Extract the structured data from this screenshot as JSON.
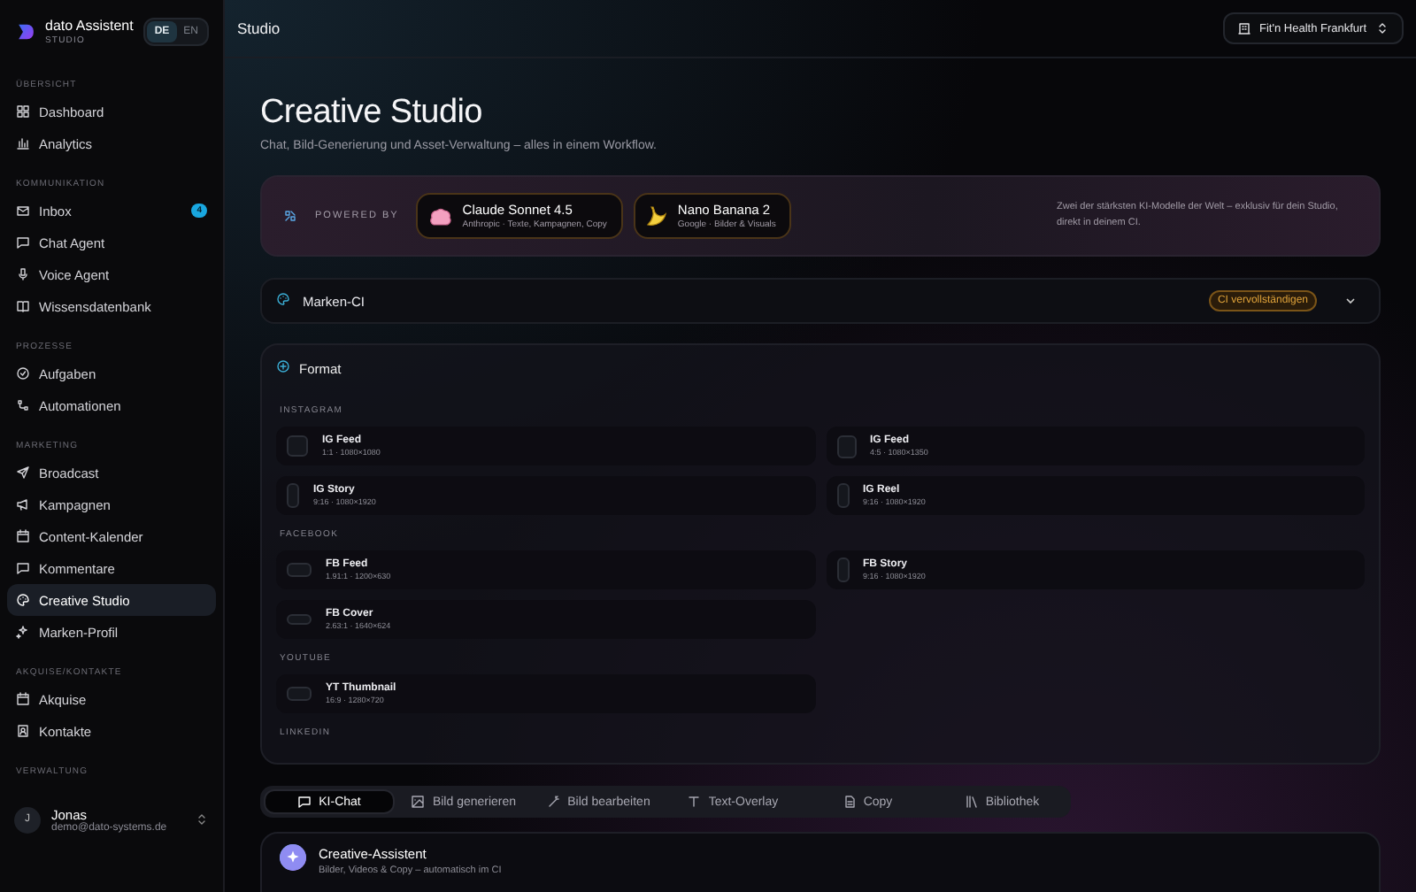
{
  "sidebar": {
    "brand": {
      "name": "dato Assistent",
      "subtitle": "STUDIO"
    },
    "languages": [
      {
        "label": "DE",
        "selected": true
      },
      {
        "label": "EN",
        "selected": false
      }
    ],
    "sections": [
      {
        "title": "ÜBERSICHT",
        "items": [
          {
            "label": "Dashboard",
            "selected": false
          },
          {
            "label": "Analytics",
            "selected": false
          }
        ]
      },
      {
        "title": "KOMMUNIKATION",
        "items": [
          {
            "label": "Inbox",
            "selected": false,
            "badge": "4"
          },
          {
            "label": "Chat Agent",
            "selected": false
          },
          {
            "label": "Voice Agent",
            "selected": false
          },
          {
            "label": "Wissensdatenbank",
            "selected": false
          }
        ]
      },
      {
        "title": "PROZESSE",
        "items": [
          {
            "label": "Aufgaben",
            "selected": false
          },
          {
            "label": "Automationen",
            "selected": false
          }
        ]
      },
      {
        "title": "MARKETING",
        "items": [
          {
            "label": "Broadcast",
            "selected": false
          },
          {
            "label": "Kampagnen",
            "selected": false
          },
          {
            "label": "Content-Kalender",
            "selected": false
          },
          {
            "label": "Kommentare",
            "selected": false
          },
          {
            "label": "Creative Studio",
            "selected": true
          },
          {
            "label": "Marken-Profil",
            "selected": false
          }
        ]
      },
      {
        "title": "AKQUISE/KONTAKTE",
        "items": [
          {
            "label": "Akquise",
            "selected": false
          },
          {
            "label": "Kontakte",
            "selected": false
          }
        ]
      },
      {
        "title": "VERWALTUNG"
      }
    ],
    "user": {
      "initial": "J",
      "name": "Jonas",
      "email": "demo@dato-systems.de"
    }
  },
  "header": {
    "title": "Studio",
    "location": "Fit'n Health Frankfurt"
  },
  "page": {
    "title": "Creative Studio",
    "subtitle": "Chat, Bild-Generierung und Asset-Verwaltung – alles in einem Workflow."
  },
  "powered": {
    "label": "POWERED BY",
    "models": [
      {
        "name": "Claude Sonnet 4.5",
        "detail": "Anthropic · Texte, Kampagnen, Copy"
      },
      {
        "name": "Nano Banana 2",
        "detail": "Google · Bilder & Visuals"
      }
    ],
    "note": "Zwei der stärksten KI-Modelle der Welt – exklusiv für dein Studio, direkt in deinem CI."
  },
  "brand_ci": {
    "label": "Marken-CI",
    "badge": "CI vervollständigen",
    "expanded": false
  },
  "format": {
    "title": "Format",
    "groups": [
      {
        "title": "INSTAGRAM",
        "options": [
          {
            "name": "IG Feed",
            "spec": "1:1 · 1080×1080",
            "kind": "square"
          },
          {
            "name": "IG Feed",
            "spec": "4:5 · 1080×1350",
            "kind": "portrait"
          },
          {
            "name": "IG Story",
            "spec": "9:16 · 1080×1920",
            "kind": "tall"
          },
          {
            "name": "IG Reel",
            "spec": "9:16 · 1080×1920",
            "kind": "tall"
          }
        ]
      },
      {
        "title": "FACEBOOK",
        "options": [
          {
            "name": "FB Feed",
            "spec": "1.91:1 · 1200×630",
            "kind": "wide"
          },
          {
            "name": "FB Story",
            "spec": "9:16 · 1080×1920",
            "kind": "tall"
          },
          {
            "name": "FB Cover",
            "spec": "2.63:1 · 1640×624",
            "kind": "banner"
          }
        ]
      },
      {
        "title": "YOUTUBE",
        "options": [
          {
            "name": "YT Thumbnail",
            "spec": "16:9 · 1280×720",
            "kind": "wide"
          }
        ]
      },
      {
        "title": "LINKEDIN"
      }
    ]
  },
  "tabs": [
    {
      "label": "KI-Chat",
      "selected": true
    },
    {
      "label": "Bild generieren",
      "selected": false
    },
    {
      "label": "Bild bearbeiten",
      "selected": false
    },
    {
      "label": "Text-Overlay",
      "selected": false
    },
    {
      "label": "Copy",
      "selected": false
    },
    {
      "label": "Bibliothek",
      "selected": false
    }
  ],
  "assistant": {
    "name": "Creative-Assistent",
    "description": "Bilder, Videos & Copy – automatisch im CI"
  }
}
